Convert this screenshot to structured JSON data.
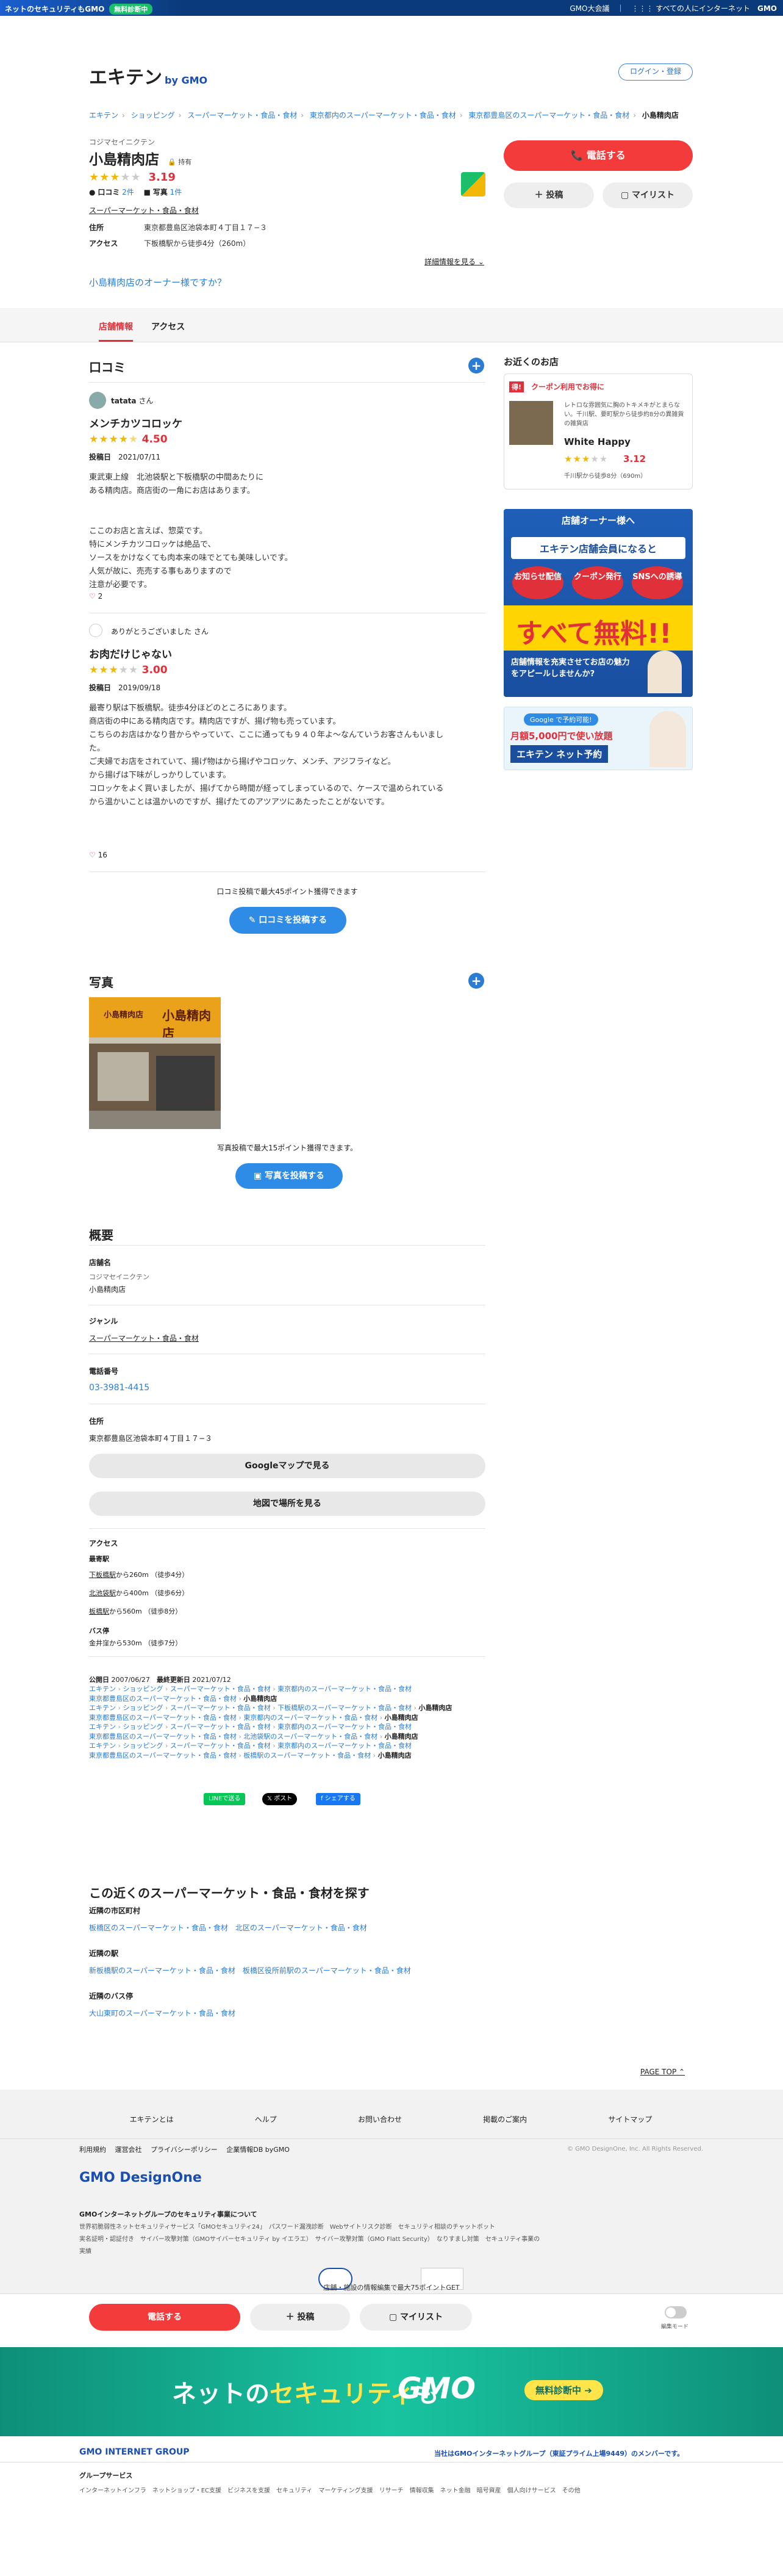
{
  "topbar": {
    "security_text": "ネットのセキュリティもGMO",
    "badge": "無料診断中",
    "right_a": "GMO大会議",
    "right_b": "すべての人にインターネット",
    "right_c": "GMO"
  },
  "header": {
    "logo": "エキテン",
    "logo_sub": "by GMO",
    "login": "ログイン・登録"
  },
  "breadcrumbs": [
    "エキテン",
    "ショッピング",
    "スーパーマーケット・食品・食材",
    "東京都内のスーパーマーケット・食品・食材",
    "東京都豊島区のスーパーマーケット・食品・食材",
    "小島精肉店"
  ],
  "shop": {
    "kana": "コジマセイニクテン",
    "name": "小島精肉店",
    "tag": "持有",
    "rating": "3.19",
    "reviews": "口コミ",
    "reviews_count": "2件",
    "photos": "写真",
    "photos_count": "1件",
    "genre": "スーパーマーケット・食品・食材",
    "addr_label": "住所",
    "addr": "東京都豊島区池袋本町４丁目１７−３",
    "access_label": "アクセス",
    "access": "下板橋駅から徒歩4分（260m）",
    "more": "詳細情報を見る",
    "owner": "小島精肉店のオーナー様ですか？"
  },
  "actions": {
    "call": "電話する",
    "post": "投稿",
    "mylist": "マイリスト"
  },
  "tabs": [
    "店舗情報",
    "アクセス"
  ],
  "reviews": {
    "title": "口コミ",
    "items": [
      {
        "user": "tatata",
        "suffix": "さん",
        "title": "メンチカツコロッケ",
        "rating": "4.50",
        "date_label": "投稿日",
        "date": "2021/07/11",
        "body": [
          "東武東上線　北池袋駅と下板橋駅の中間あたりに",
          "ある精肉店。商店街の一角にお店はあります。",
          "",
          "ここのお店と言えば、惣菜です。",
          "特にメンチカツコロッケは絶品で、",
          "ソースをかけなくても肉本来の味でとても美味しいです。",
          "人気が故に、売売する事もありますので",
          "注意が必要です。"
        ],
        "likes": "2"
      },
      {
        "user": "ありがとうございました",
        "suffix": "さん",
        "title": "お肉だけじゃない",
        "rating": "3.00",
        "date_label": "投稿日",
        "date": "2019/09/18",
        "body": [
          "最寄り駅は下板橋駅。徒歩4分ほどのところにあります。",
          "商店街の中にある精肉店です。精肉店ですが、揚げ物も売っています。",
          "こちらのお店はかなり昔からやっていて、ここに通っても９４０年よ〜なんていうお客さんもいまし",
          "た。",
          "ご夫婦でお店をされていて、揚げ物はから揚げやコロッケ、メンチ、アジフライなど。",
          "から揚げは下味がしっかりしています。",
          "コロッケをよく買いましたが、揚げてから時間が経ってしまっているので、ケースで温められている",
          "から温かいことは温かいのですが、揚げたてのアツアツにあたったことがないです。"
        ],
        "likes": "16"
      }
    ],
    "promo": "口コミ投稿で最大45ポイント獲得できます",
    "post_btn": "口コミを投稿する"
  },
  "photos": {
    "title": "写真",
    "sign": "小島精肉店",
    "promo": "写真投稿で最大15ポイント獲得できます。",
    "post_btn": "写真を投稿する"
  },
  "overview": {
    "title": "概要",
    "name_label": "店舗名",
    "name_kana": "コジマセイニクテン",
    "name": "小島精肉店",
    "genre_label": "ジャンル",
    "genre": "スーパーマーケット・食品・食材",
    "tel_label": "電話番号",
    "tel": "03-3981-4415",
    "addr_label": "住所",
    "addr": "東京都豊島区池袋本町４丁目１７−３",
    "map_btn": "Googleマップで見る",
    "map_btn2": "地図で場所を見る",
    "access_label": "アクセス",
    "station_label": "最寄駅",
    "stations": [
      {
        "name": "下板橋駅",
        "rest": "から260m （徒歩4分）"
      },
      {
        "name": "北池袋駅",
        "rest": "から400m （徒歩6分）"
      },
      {
        "name": "板橋駅",
        "rest": "から560m （徒歩8分）"
      }
    ],
    "bus_label": "バス停",
    "bus": "金井窪から530m （徒歩7分）",
    "published_label": "公開日",
    "published": "2007/06/27",
    "updated_label": "最終更新日",
    "updated": "2021/07/12"
  },
  "crumb_rows": [
    [
      "エキテン",
      "ショッピング",
      "スーパーマーケット・食品・食材",
      "東京都内のスーパーマーケット・食品・食材"
    ],
    [
      "東京都豊島区のスーパーマーケット・食品・食材",
      "小島精肉店"
    ],
    [
      "エキテン",
      "ショッピング",
      "スーパーマーケット・食品・食材",
      "下板橋駅のスーパーマーケット・食品・食材",
      "小島精肉店"
    ],
    [
      "東京都豊島区のスーパーマーケット・食品・食材",
      "東京都内のスーパーマーケット・食品・食材",
      "小島精肉店"
    ],
    [
      "エキテン",
      "ショッピング",
      "スーパーマーケット・食品・食材",
      "東京都内のスーパーマーケット・食品・食材"
    ],
    [
      "東京都豊島区のスーパーマーケット・食品・食材",
      "北池袋駅のスーパーマーケット・食品・食材",
      "小島精肉店"
    ],
    [
      "エキテン",
      "ショッピング",
      "スーパーマーケット・食品・食材",
      "東京都内のスーパーマーケット・食品・食材"
    ],
    [
      "東京都豊島区のスーパーマーケット・食品・食材",
      "板橋駅のスーパーマーケット・食品・食材",
      "小島精肉店"
    ]
  ],
  "share": {
    "line": "LINEで送る",
    "x": "ポスト",
    "fb": "シェアする"
  },
  "nearby": {
    "title": "この近くのスーパーマーケット・食品・食材を探す",
    "city_label": "近隣の市区町村",
    "cities": [
      "板橋区のスーパーマーケット・食品・食材",
      "北区のスーパーマーケット・食品・食材"
    ],
    "station_label": "近隣の駅",
    "stations": [
      "新板橋駅のスーパーマーケット・食品・食材",
      "板橋区役所前駅のスーパーマーケット・食品・食材"
    ],
    "bus_label": "近隣のバス停",
    "buses": [
      "大山東町のスーパーマーケット・食品・食材"
    ]
  },
  "sidebar": {
    "title": "お近くのお店",
    "coupon_tag": "得!",
    "coupon": "クーポン利用でお得に",
    "desc": "レトロな雰囲気に胸のトキメキがとまらない。千川駅、要町駅から徒歩約8分の異雑貨の雑貨店",
    "shop": "White Happy",
    "rating": "3.12",
    "access": "千川駅から徒歩8分（690m）",
    "ad1_top": "店舗オーナー様へ",
    "ad1_main": "エキテン店舗会員になると",
    "ad1_b1": "お知らせ配信",
    "ad1_b2": "クーポン発行",
    "ad1_b3": "SNSへの誘導",
    "ad1_big": "すべて無料!!",
    "ad1_sub": "店舗情報を充実させてお店の魅力をアピールしませんか?",
    "ad2_top": "Google で予約可能!",
    "ad2_price": "月額5,000円で使い放題",
    "ad2_main": "エキテン ネット予約"
  },
  "page_top": "PAGE TOP",
  "footer": {
    "links": [
      "エキテンとは",
      "ヘルプ",
      "お問い合わせ",
      "掲載のご案内",
      "サイトマップ"
    ],
    "sub": [
      "利用規約",
      "運営会社",
      "プライバシーポリシー",
      "企業情報DB byGMO"
    ],
    "copy": "© GMO DesignOne, Inc. All Rights Reserved.",
    "brand": "GMO DesignOne",
    "group_title": "GMOインターネットグループのセキュリティ事業について",
    "group_links": [
      "世界初脆弱性ネットセキュリティサービス「GMOセキュリティ24」",
      "パスワード漏洩診断",
      "Webサイトリスク診断",
      "セキュリティ相談のチャットボット",
      "実名証明・認証付き",
      "サイバー攻撃対策（GMOサイバーセキュリティ by イエラエ）",
      "サイバー攻撃対策（GMO Flatt Security）",
      "なりすまし対策",
      "セキュリティ事業の実績"
    ],
    "notice": "店舗・施設の情報編集で最大75ポイントGET"
  },
  "bottom_bar": {
    "call": "電話する",
    "post": "投稿",
    "mylist": "マイリスト",
    "mode": "編集モード"
  },
  "banner": {
    "text_a": "ネットの",
    "text_b": "セキュリティ",
    "text_c": "も",
    "brand": "GMO",
    "btn": "無料診断中"
  },
  "group_footer": {
    "logo": "GMO INTERNET GROUP",
    "member": "当社はGMOインターネットグループ（東証プライム上場9449）のメンバーです。",
    "title": "グループサービス",
    "links": [
      "インターネットインフラ",
      "ネットショップ・EC支援",
      "ビジネスを支援",
      "セキュリティ",
      "マーケティング支援",
      "リサーチ",
      "情報収集",
      "ネット金融",
      "暗号資産",
      "個人向けサービス",
      "その他"
    ]
  }
}
